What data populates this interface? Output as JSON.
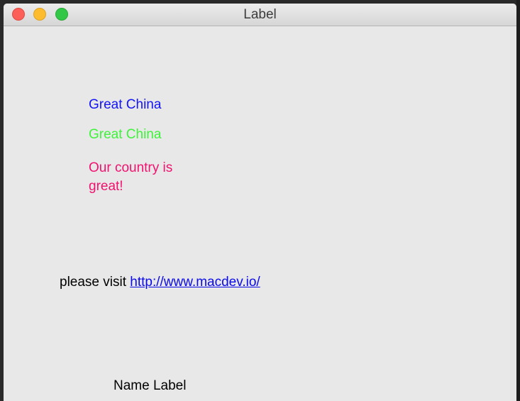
{
  "window": {
    "title": "Label"
  },
  "labels": {
    "blue": {
      "text": "Great China",
      "color": "#1414f5"
    },
    "green": {
      "text": "Great China",
      "color": "#3ef23a"
    },
    "pink": {
      "text": "Our country is great!",
      "color": "#f0126e"
    },
    "visit": {
      "prefix": "please visit ",
      "link_text": "http://www.macdev.io/",
      "link_color": "#0b0bea"
    },
    "name": {
      "text": "Name Label"
    }
  }
}
